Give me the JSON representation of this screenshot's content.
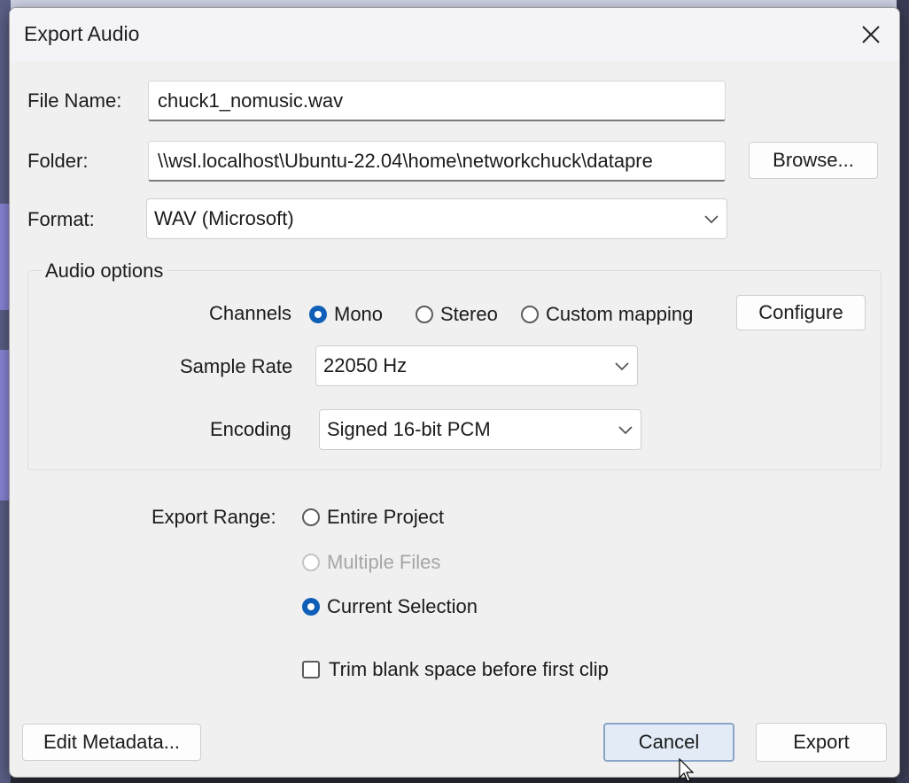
{
  "dialog": {
    "title": "Export Audio",
    "close_icon": "close-icon"
  },
  "file_name": {
    "label": "File Name:",
    "value": "chuck1_nomusic.wav"
  },
  "folder": {
    "label": "Folder:",
    "value": "\\\\wsl.localhost\\Ubuntu-22.04\\home\\networkchuck\\datapre",
    "browse_label": "Browse..."
  },
  "format": {
    "label": "Format:",
    "value": "WAV (Microsoft)"
  },
  "audio_options": {
    "title": "Audio options",
    "channels": {
      "label": "Channels",
      "options": [
        "Mono",
        "Stereo",
        "Custom mapping"
      ],
      "selected": "Mono",
      "configure_label": "Configure"
    },
    "sample_rate": {
      "label": "Sample Rate",
      "value": "22050 Hz"
    },
    "encoding": {
      "label": "Encoding",
      "value": "Signed 16-bit PCM"
    }
  },
  "export_range": {
    "label": "Export Range:",
    "options": [
      "Entire Project",
      "Multiple Files",
      "Current Selection"
    ],
    "selected": "Current Selection",
    "disabled": [
      "Multiple Files"
    ]
  },
  "trim": {
    "label": "Trim blank space before first clip",
    "checked": false
  },
  "buttons": {
    "edit_metadata": "Edit Metadata...",
    "cancel": "Cancel",
    "export": "Export"
  },
  "colors": {
    "accent": "#0f5fb8",
    "dialog_bg": "#f0f0f0"
  }
}
